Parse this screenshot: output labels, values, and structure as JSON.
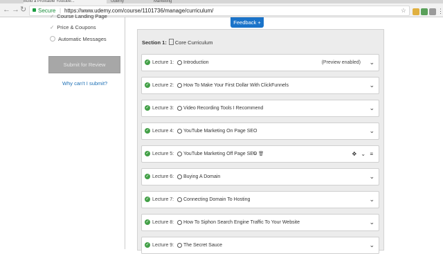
{
  "browser": {
    "tabs": [
      "Build a Profitable Youtube...",
      "Udemy",
      "Marketing"
    ],
    "secure_label": "Secure",
    "url": "https://www.udemy.com/course/1101736/manage/curriculum/"
  },
  "sidebar": {
    "items": [
      {
        "label": "Course Landing Page",
        "state": "check"
      },
      {
        "label": "Price & Coupons",
        "state": "check"
      },
      {
        "label": "Automatic Messages",
        "state": "circle"
      }
    ],
    "submit_label": "Submit for Review",
    "why_link": "Why can't I submit?"
  },
  "feedback_label": "Feedback +",
  "curriculum": {
    "section_label": "Section 1:",
    "section_title": "Core Curriculum",
    "lectures": [
      {
        "num": "Lecture 1:",
        "title": "Introduction",
        "extra": "(Preview enabled)"
      },
      {
        "num": "Lecture 2:",
        "title": "How To Make Your First Dollar With ClickFunnels",
        "extra": ""
      },
      {
        "num": "Lecture 3:",
        "title": "Video Recording Tools I Recommend",
        "extra": ""
      },
      {
        "num": "Lecture 4:",
        "title": "YouTube Marketing On Page SEO",
        "extra": ""
      },
      {
        "num": "Lecture 5:",
        "title": "YouTube Marketing Off Page SEO",
        "extra": ""
      },
      {
        "num": "Lecture 6:",
        "title": "Buying A Domain",
        "extra": ""
      },
      {
        "num": "Lecture 7:",
        "title": "Connecting Domain To Hosting",
        "extra": ""
      },
      {
        "num": "Lecture 8:",
        "title": "How To Siphon Search Engine Traffic To Your Website",
        "extra": ""
      },
      {
        "num": "Lecture 9:",
        "title": "The Secret Sauce",
        "extra": ""
      }
    ]
  },
  "icons": {
    "check": "check-icon",
    "play": "play-circle-icon",
    "chevron": "chevron-down-icon",
    "move": "move-icon",
    "menu": "hamburger-icon",
    "edit": "pencil-icon",
    "delete": "trash-icon"
  },
  "colors": {
    "accent_blue": "#1a73c9",
    "success_green": "#43a047",
    "submit_disabled": "#a7a7a7"
  }
}
